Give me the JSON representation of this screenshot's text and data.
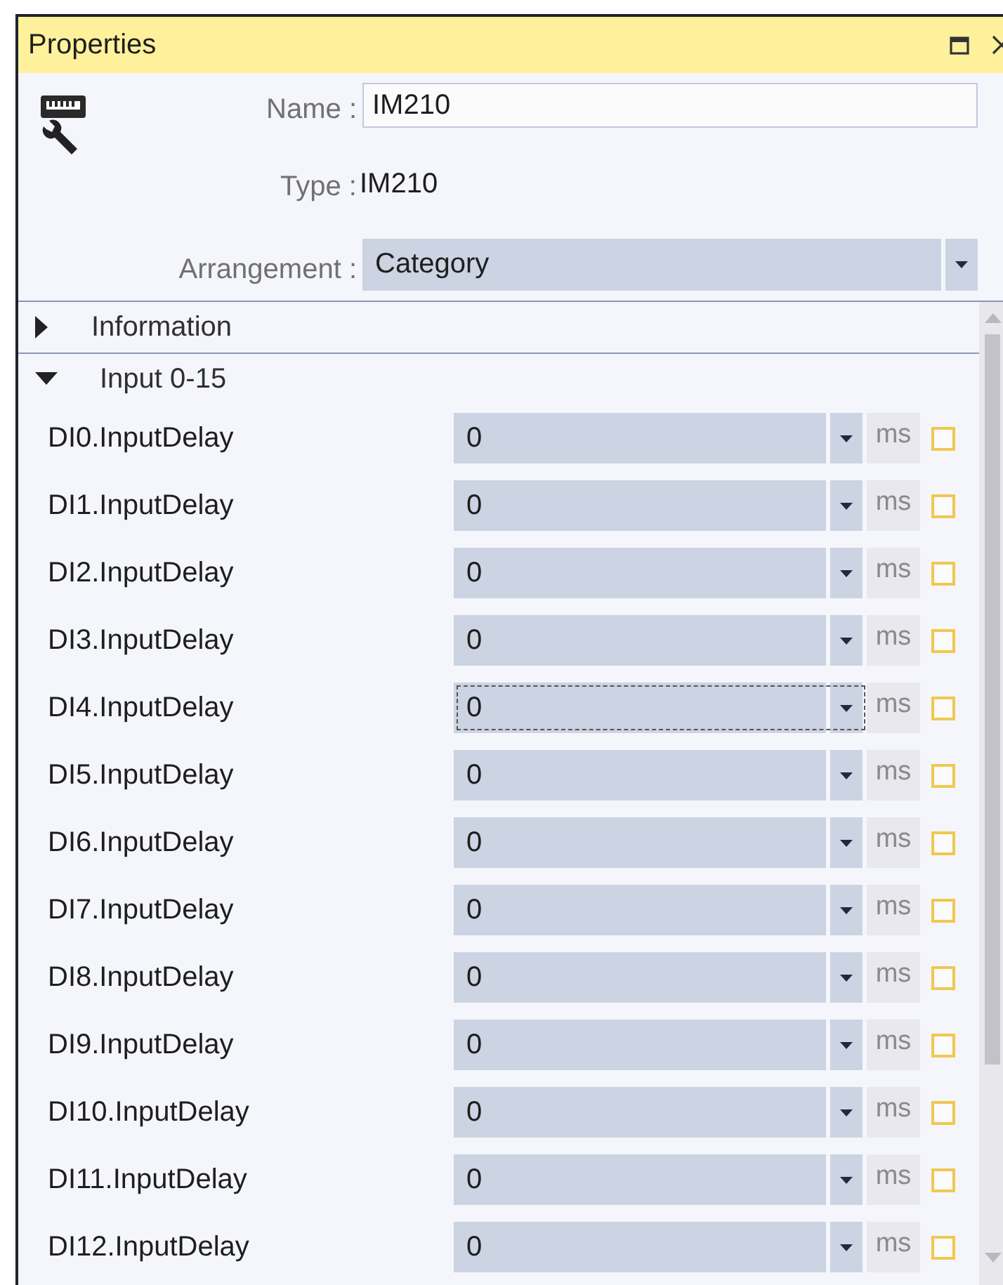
{
  "window": {
    "title": "Properties"
  },
  "header": {
    "name_label": "Name :",
    "name_value": "IM210",
    "type_label": "Type :",
    "type_value": "IM210",
    "arrangement_label": "Arrangement :",
    "arrangement_value": "Category"
  },
  "categories": [
    {
      "label": "Information",
      "expanded": false
    },
    {
      "label": "Input 0-15",
      "expanded": true,
      "children": [
        {
          "name": "DI0.InputDelay",
          "value": "0",
          "unit": "ms",
          "checked": false,
          "focused": false
        },
        {
          "name": "DI1.InputDelay",
          "value": "0",
          "unit": "ms",
          "checked": false,
          "focused": false
        },
        {
          "name": "DI2.InputDelay",
          "value": "0",
          "unit": "ms",
          "checked": false,
          "focused": false
        },
        {
          "name": "DI3.InputDelay",
          "value": "0",
          "unit": "ms",
          "checked": false,
          "focused": false
        },
        {
          "name": "DI4.InputDelay",
          "value": "0",
          "unit": "ms",
          "checked": false,
          "focused": true
        },
        {
          "name": "DI5.InputDelay",
          "value": "0",
          "unit": "ms",
          "checked": false,
          "focused": false
        },
        {
          "name": "DI6.InputDelay",
          "value": "0",
          "unit": "ms",
          "checked": false,
          "focused": false
        },
        {
          "name": "DI7.InputDelay",
          "value": "0",
          "unit": "ms",
          "checked": false,
          "focused": false
        },
        {
          "name": "DI8.InputDelay",
          "value": "0",
          "unit": "ms",
          "checked": false,
          "focused": false
        },
        {
          "name": "DI9.InputDelay",
          "value": "0",
          "unit": "ms",
          "checked": false,
          "focused": false
        },
        {
          "name": "DI10.InputDelay",
          "value": "0",
          "unit": "ms",
          "checked": false,
          "focused": false
        },
        {
          "name": "DI11.InputDelay",
          "value": "0",
          "unit": "ms",
          "checked": false,
          "focused": false
        },
        {
          "name": "DI12.InputDelay",
          "value": "0",
          "unit": "ms",
          "checked": false,
          "focused": false
        }
      ]
    }
  ]
}
